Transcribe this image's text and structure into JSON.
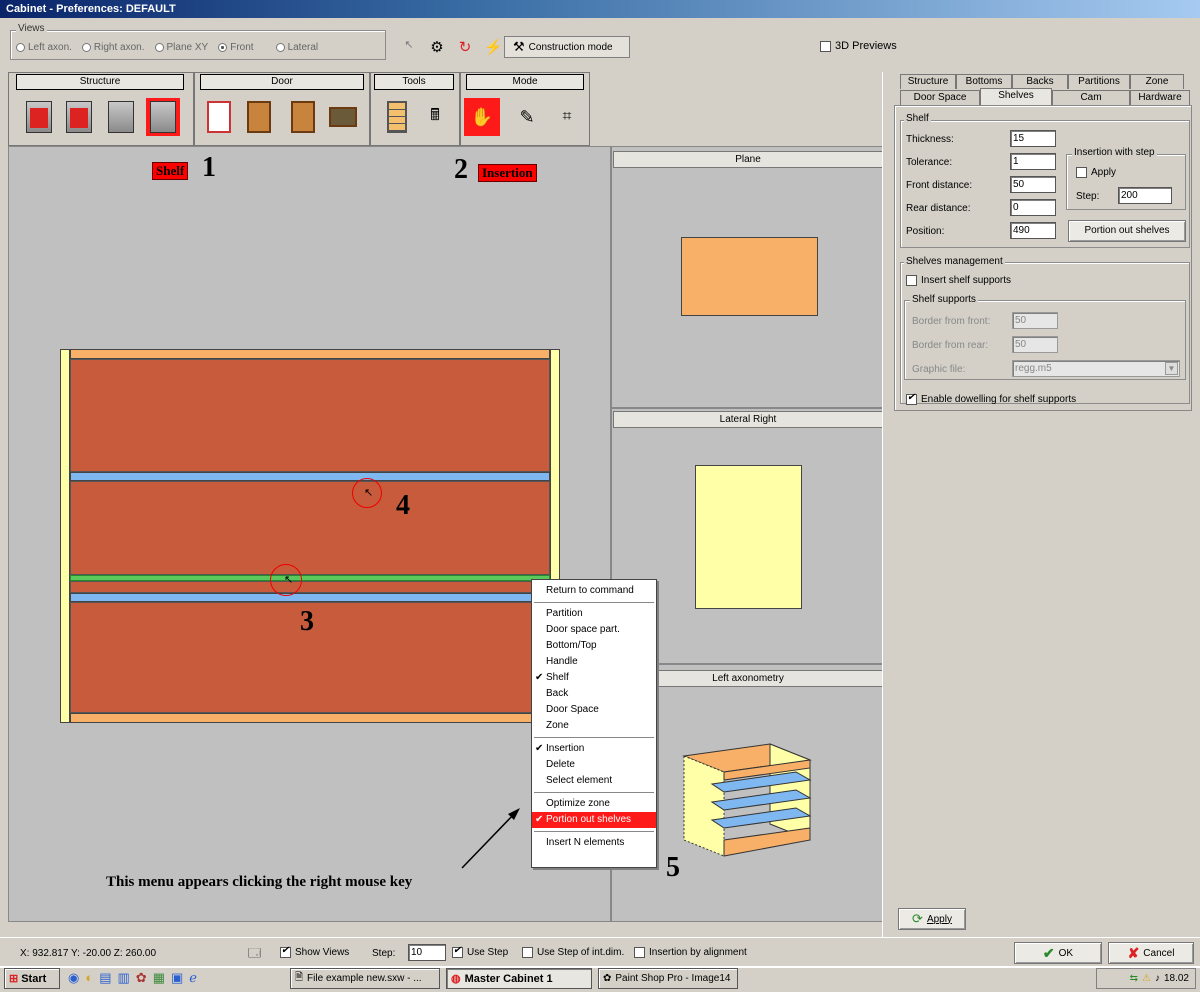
{
  "window": {
    "title": "Cabinet - Preferences: DEFAULT"
  },
  "views": {
    "title": "Views",
    "options": [
      "Left axon.",
      "Right axon.",
      "Plane XY",
      "Front",
      "Lateral"
    ],
    "construction_mode": "Construction mode",
    "preview_3d": "3D Previews"
  },
  "toolbar": {
    "groups": [
      "Structure",
      "Door",
      "Tools",
      "Mode"
    ]
  },
  "labels": {
    "shelf": "Shelf",
    "insertion": "Insertion",
    "n1": "1",
    "n2": "2",
    "n3": "3",
    "n4": "4",
    "n5": "5",
    "caption": "This menu appears clicking the right mouse key"
  },
  "panes": {
    "plane": "Plane",
    "lateral": "Lateral Right",
    "axon": "Left axonometry"
  },
  "context_menu": {
    "return": "Return to command",
    "partition": "Partition",
    "door_space_part": "Door space part.",
    "bottom_top": "Bottom/Top",
    "handle": "Handle",
    "shelf": "Shelf",
    "back": "Back",
    "door_space": "Door Space",
    "zone": "Zone",
    "insertion": "Insertion",
    "delete": "Delete",
    "select_element": "Select element",
    "optimize_zone": "Optimize zone",
    "portion_out": "Portion out shelves",
    "insert_n": "Insert N elements"
  },
  "props": {
    "tabs_row1": [
      "Structure",
      "Bottoms",
      "Backs",
      "Partitions",
      "Zone"
    ],
    "tabs_row2": [
      "Door Space",
      "Shelves",
      "Cam",
      "Hardware"
    ],
    "shelf_group": "Shelf",
    "thickness_label": "Thickness:",
    "thickness": "15",
    "tolerance_label": "Tolerance:",
    "tolerance": "1",
    "front_label": "Front distance:",
    "front": "50",
    "rear_label": "Rear distance:",
    "rear": "0",
    "position_label": "Position:",
    "position": "490",
    "step_group": "Insertion with step",
    "apply_label": "Apply",
    "step_label": "Step:",
    "step": "200",
    "portion_button": "Portion out shelves",
    "mgmt_group": "Shelves management",
    "insert_supports": "Insert shelf supports",
    "supports_group": "Shelf supports",
    "border_front_label": "Border from front:",
    "border_front": "50",
    "border_rear_label": "Border from rear:",
    "border_rear": "50",
    "graphic_label": "Graphic file:",
    "graphic": "regg.m5",
    "dowelling": "Enable dowelling for shelf supports",
    "apply_button": "Apply"
  },
  "status": {
    "coords": "X: 932.817 Y: -20.00 Z: 260.00",
    "show_views": "Show Views",
    "step_label": "Step:",
    "step": "10",
    "use_step": "Use Step",
    "use_step_int": "Use Step of int.dim.",
    "insertion_align": "Insertion by alignment",
    "ok": "OK",
    "cancel": "Cancel"
  },
  "taskbar": {
    "start": "Start",
    "tasks": [
      "File example new.sxw - ...",
      "Master Cabinet 1",
      "Paint Shop Pro - Image14"
    ],
    "clock": "18.02"
  },
  "colors": {
    "accent_red": "#ff1a1a",
    "cabinet_cell": "#c85b3b",
    "shelf_blue": "#7fb7f0",
    "side_yellow": "#ffffa8",
    "top_orange": "#f8b068"
  }
}
